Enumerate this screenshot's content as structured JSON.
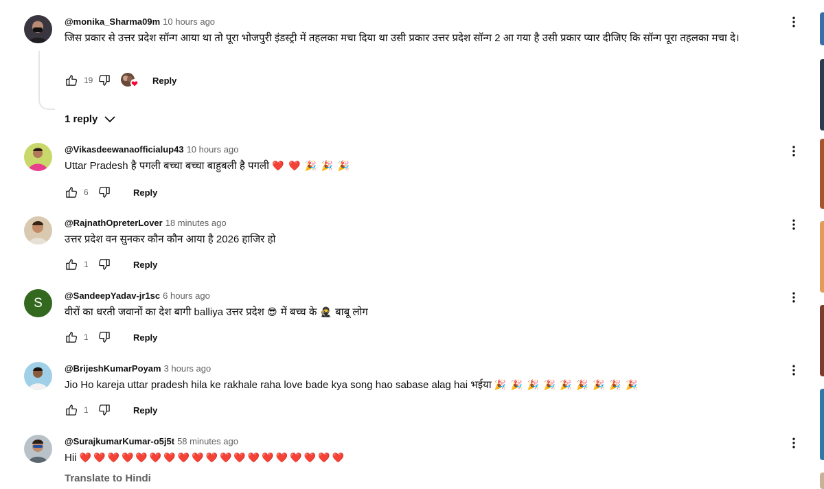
{
  "comments": [
    {
      "handle": "@monika_Sharma09m",
      "time": "10 hours ago",
      "text": "जिस प्रकार से उत्तर प्रदेश सॉन्ग आया था तो पूरा भोजपुरी इंडस्ट्री में तहलका मचा दिया था उसी प्रकार उत्तर प्रदेश सॉन्ग 2 आ गया है उसी प्रकार प्यार  दीजिए कि  सॉन्ग पूरा तहलका मचा दे।",
      "likes": "19",
      "reply_label": "Reply",
      "replies_toggle": "1 reply"
    },
    {
      "handle": "@Vikasdeewanaofficialup43",
      "time": "10 hours ago",
      "text": "Uttar Pradesh है पगली बच्चा बच्चा बाहुबली है पगली",
      "emoji": "❤️ ❤️ 🎉 🎉 🎉",
      "likes": "6",
      "reply_label": "Reply"
    },
    {
      "handle": "@RajnathOpreterLover",
      "time": "18 minutes ago",
      "text": "उत्तर प्रदेश वन सुनकर कौन कौन आया है 2026 हाजिर हो",
      "likes": "1",
      "reply_label": "Reply"
    },
    {
      "handle": "@SandeepYadav-jr1sc",
      "time": "6 hours ago",
      "avatar_letter": "S",
      "text_a": "वीरों का धरती जवानों का देश बागी balliya उत्तर प्रदेश",
      "emoji_a": "😎",
      "text_b": "में बच्च के",
      "emoji_b": "🥷",
      "text_c": "बाबू लोग",
      "likes": "1",
      "reply_label": "Reply"
    },
    {
      "handle": "@BrijeshKumarPoyam",
      "time": "3 hours ago",
      "text": "Jio Ho kareja uttar pradesh hila ke rakhale raha love bade kya song hao sabase alag hai भईया",
      "emoji": "🎉 🎉 🎉 🎉 🎉 🎉 🎉 🎉 🎉",
      "likes": "1",
      "reply_label": "Reply"
    },
    {
      "handle": "@SurajkumarKumar-o5j5t",
      "time": "58 minutes ago",
      "text": "Hii",
      "emoji": "❤️❤️❤️❤️❤️❤️❤️❤️❤️❤️❤️❤️❤️❤️❤️❤️❤️❤️❤️",
      "translate": "Translate to Hindi"
    }
  ],
  "icons": {
    "like": "thumb-up-icon",
    "dislike": "thumb-down-icon",
    "more": "more-vertical-icon",
    "chevron": "chevron-down-icon",
    "creator_heart": "creator-heart-icon"
  },
  "colors": {
    "text": "#0f0f0f",
    "secondary": "#606060",
    "heart": "#ff0033",
    "avatar_s": "#33691e"
  }
}
